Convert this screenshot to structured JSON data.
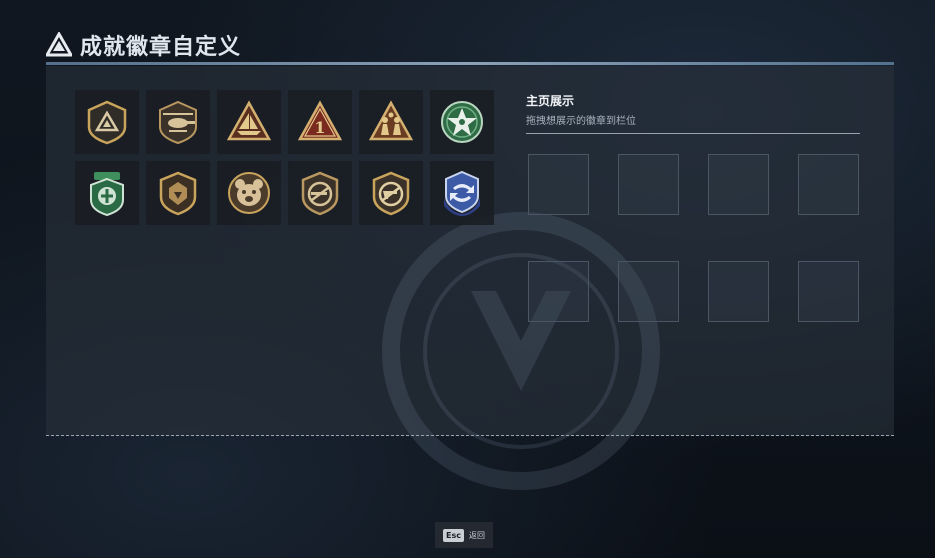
{
  "header": {
    "title": "成就徽章自定义",
    "icon": "triangle-logo-icon"
  },
  "badges": [
    {
      "name": "badge-pyramid",
      "icon": "pyramid-shield-icon"
    },
    {
      "name": "badge-helicopter",
      "icon": "helicopter-icon"
    },
    {
      "name": "badge-boat-triangle",
      "icon": "boat-triangle-icon"
    },
    {
      "name": "badge-number-one",
      "icon": "number-one-triangle-icon",
      "text": "1"
    },
    {
      "name": "badge-soldiers-triangle",
      "icon": "soldiers-triangle-icon"
    },
    {
      "name": "badge-green-star",
      "icon": "green-star-icon"
    },
    {
      "name": "badge-green-medal",
      "icon": "green-medal-icon"
    },
    {
      "name": "badge-lion-shield",
      "icon": "lion-shield-icon"
    },
    {
      "name": "badge-bear-head",
      "icon": "bear-head-icon"
    },
    {
      "name": "badge-no-gun",
      "icon": "no-gun-icon"
    },
    {
      "name": "badge-no-pistol",
      "icon": "no-pistol-icon"
    },
    {
      "name": "badge-blue-arrows",
      "icon": "blue-arrows-shield-icon"
    }
  ],
  "showcase": {
    "title": "主页展示",
    "subtitle": "拖拽想展示的徽章到栏位",
    "slots": [
      {},
      {},
      {},
      {},
      {},
      {},
      {},
      {}
    ]
  },
  "footer": {
    "key": "Esc",
    "label": "返回"
  },
  "colors": {
    "gold": "#c9a45c",
    "green": "#3f8f5d",
    "blue": "#3d5aa6",
    "panel": "#28303a"
  }
}
